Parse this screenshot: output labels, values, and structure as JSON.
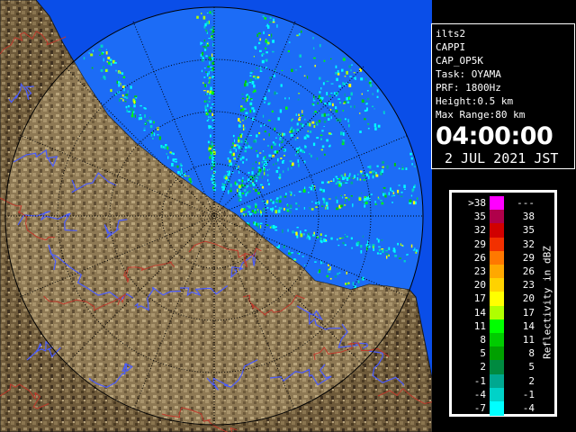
{
  "info": {
    "radar_id": "ilts2",
    "product": "CAPPI",
    "cap_name": "CAP_OP5K",
    "task": "Task: OYAMA",
    "prf": "PRF: 1800Hz",
    "height": "Height:0.5 km",
    "max_range": "Max Range:80 km",
    "time": "04:00:00",
    "date": "2 JUL 2021 JST"
  },
  "legend": {
    "unit_label": "Reflectivity in dBZ",
    "rows": [
      {
        "lo": ">38",
        "hi": "---",
        "color": "#ff00ff"
      },
      {
        "lo": "35",
        "hi": "38",
        "color": "#b0004a"
      },
      {
        "lo": "32",
        "hi": "35",
        "color": "#d10000"
      },
      {
        "lo": "29",
        "hi": "32",
        "color": "#f23000"
      },
      {
        "lo": "26",
        "hi": "29",
        "color": "#ff7800"
      },
      {
        "lo": "23",
        "hi": "26",
        "color": "#ffa800"
      },
      {
        "lo": "20",
        "hi": "23",
        "color": "#ffd200"
      },
      {
        "lo": "17",
        "hi": "20",
        "color": "#ffff00"
      },
      {
        "lo": "14",
        "hi": "17",
        "color": "#b0ff00"
      },
      {
        "lo": "11",
        "hi": "14",
        "color": "#00ff00"
      },
      {
        "lo": "8",
        "hi": "11",
        "color": "#00cc00"
      },
      {
        "lo": "5",
        "hi": "8",
        "color": "#00a000"
      },
      {
        "lo": "2",
        "hi": "5",
        "color": "#008a40"
      },
      {
        "lo": "-1",
        "hi": "2",
        "color": "#00a890"
      },
      {
        "lo": "-4",
        "hi": "-1",
        "color": "#00d2c8"
      },
      {
        "lo": "-7",
        "hi": "-4",
        "color": "#00ffff"
      }
    ]
  },
  "colors": {
    "sea": "#0a4ee8",
    "range_disk": "#1c6cf6",
    "land": "#6e5a3a",
    "land_light": "#a8936a",
    "coast": "#1a1a1a",
    "river": "#4a5cff",
    "boundary": "#c0392b",
    "grid": "#000000"
  }
}
